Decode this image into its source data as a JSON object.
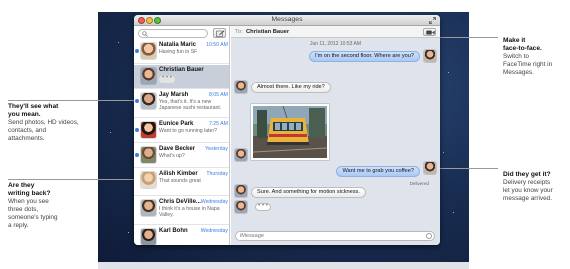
{
  "window": {
    "title": "Messages"
  },
  "sidebar": {
    "search_placeholder": "",
    "conversations": [
      {
        "name": "Natalia Maric",
        "time": "10:50 AM",
        "preview": "Having fun in SF",
        "unread": true
      },
      {
        "name": "Christian Bauer",
        "time": "",
        "preview": "",
        "typing": true,
        "selected": true
      },
      {
        "name": "Jay Marsh",
        "time": "8:05 AM",
        "preview": "Yes, that's it. It's a new Japanese sushi restaurant.",
        "unread": true
      },
      {
        "name": "Eunice Park",
        "time": "7:25 AM",
        "preview": "Want to go running later?",
        "unread": true
      },
      {
        "name": "Dave Becker",
        "time": "Yesterday",
        "preview": "What's up?",
        "unread": true
      },
      {
        "name": "Ailish Kimber",
        "time": "Thursday",
        "preview": "That sounds great",
        "unread": false
      },
      {
        "name": "Chris DeVille...",
        "time": "Wednesday",
        "preview": "I think it's a house in Napa Valley.",
        "unread": false
      },
      {
        "name": "Karl Bohn",
        "time": "Wednesday",
        "preview": "",
        "unread": false
      }
    ]
  },
  "chat": {
    "to_label": "To:",
    "to_name": "Christian Bauer",
    "date": "Jun 11, 2012 10:53 AM",
    "messages": [
      {
        "dir": "out",
        "text": "I'm on the second floor. Where are you?"
      },
      {
        "dir": "in",
        "text": "Almost there. Like my ride?"
      },
      {
        "dir": "out",
        "text": "Want me to grab you coffee?"
      },
      {
        "dir": "in",
        "text": "Sure. And something for motion sickness."
      }
    ],
    "delivered": "Delivered",
    "typing": "• • •",
    "input_placeholder": "iMessage"
  },
  "callouts": {
    "facetime": {
      "head1": "Make it",
      "head2": "face-to-face.",
      "body": [
        "Switch to",
        "FaceTime right in",
        "Messages."
      ]
    },
    "mean": {
      "head1": "They'll see what",
      "head2": "you mean.",
      "body": [
        "Send photos, HD videos,",
        "contacts, and",
        "attachments."
      ]
    },
    "writing": {
      "head1": "Are they",
      "head2": "writing back?",
      "body": [
        "When you see",
        "three dots,",
        "someone's typing",
        "a reply."
      ]
    },
    "delivered": {
      "head": "Did they get it?",
      "body": [
        "Delivery receipts",
        "let you know your",
        "message arrived."
      ]
    }
  },
  "colors": {
    "accent": "#3b7ee0",
    "selected_row": "#c8cfdb",
    "outgoing_bubble": "#b9d4f7"
  }
}
